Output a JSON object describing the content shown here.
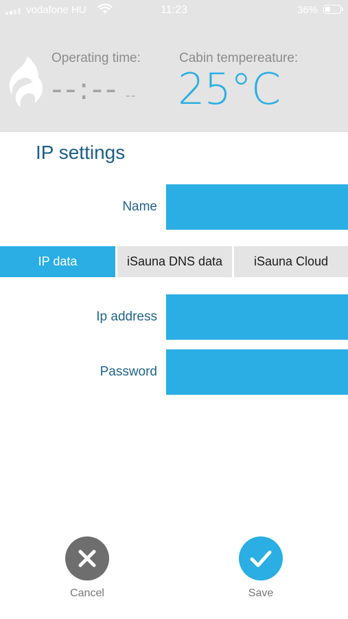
{
  "status_bar": {
    "carrier": "vodafone HU",
    "time": "11:23",
    "battery_percent": "36%",
    "battery_level": 0.36
  },
  "header": {
    "operating_time_label": "Operating time:",
    "operating_time_value": "--:--",
    "operating_time_sub": "--",
    "cabin_temp_label": "Cabin tempereature:",
    "cabin_temp_value": "25°C",
    "accent_color": "#2aaee3"
  },
  "page": {
    "title": "IP settings"
  },
  "form": {
    "name_label": "Name",
    "name_value": ""
  },
  "tabs": [
    {
      "label": "IP data",
      "active": true
    },
    {
      "label": "iSauna DNS data",
      "active": false
    },
    {
      "label": "iSauna Cloud",
      "active": false
    }
  ],
  "ip_form": {
    "ip_address_label": "Ip address",
    "ip_address_value": "",
    "password_label": "Password",
    "password_value": ""
  },
  "actions": {
    "cancel_label": "Cancel",
    "cancel_color": "#6e6e6e",
    "save_label": "Save",
    "save_color": "#2aaee3"
  },
  "icons": {
    "logo": "flame-logo-icon",
    "cancel": "close-icon",
    "save": "checkmark-icon",
    "wifi": "wifi-icon",
    "signal": "signal-icon",
    "battery": "battery-icon"
  }
}
